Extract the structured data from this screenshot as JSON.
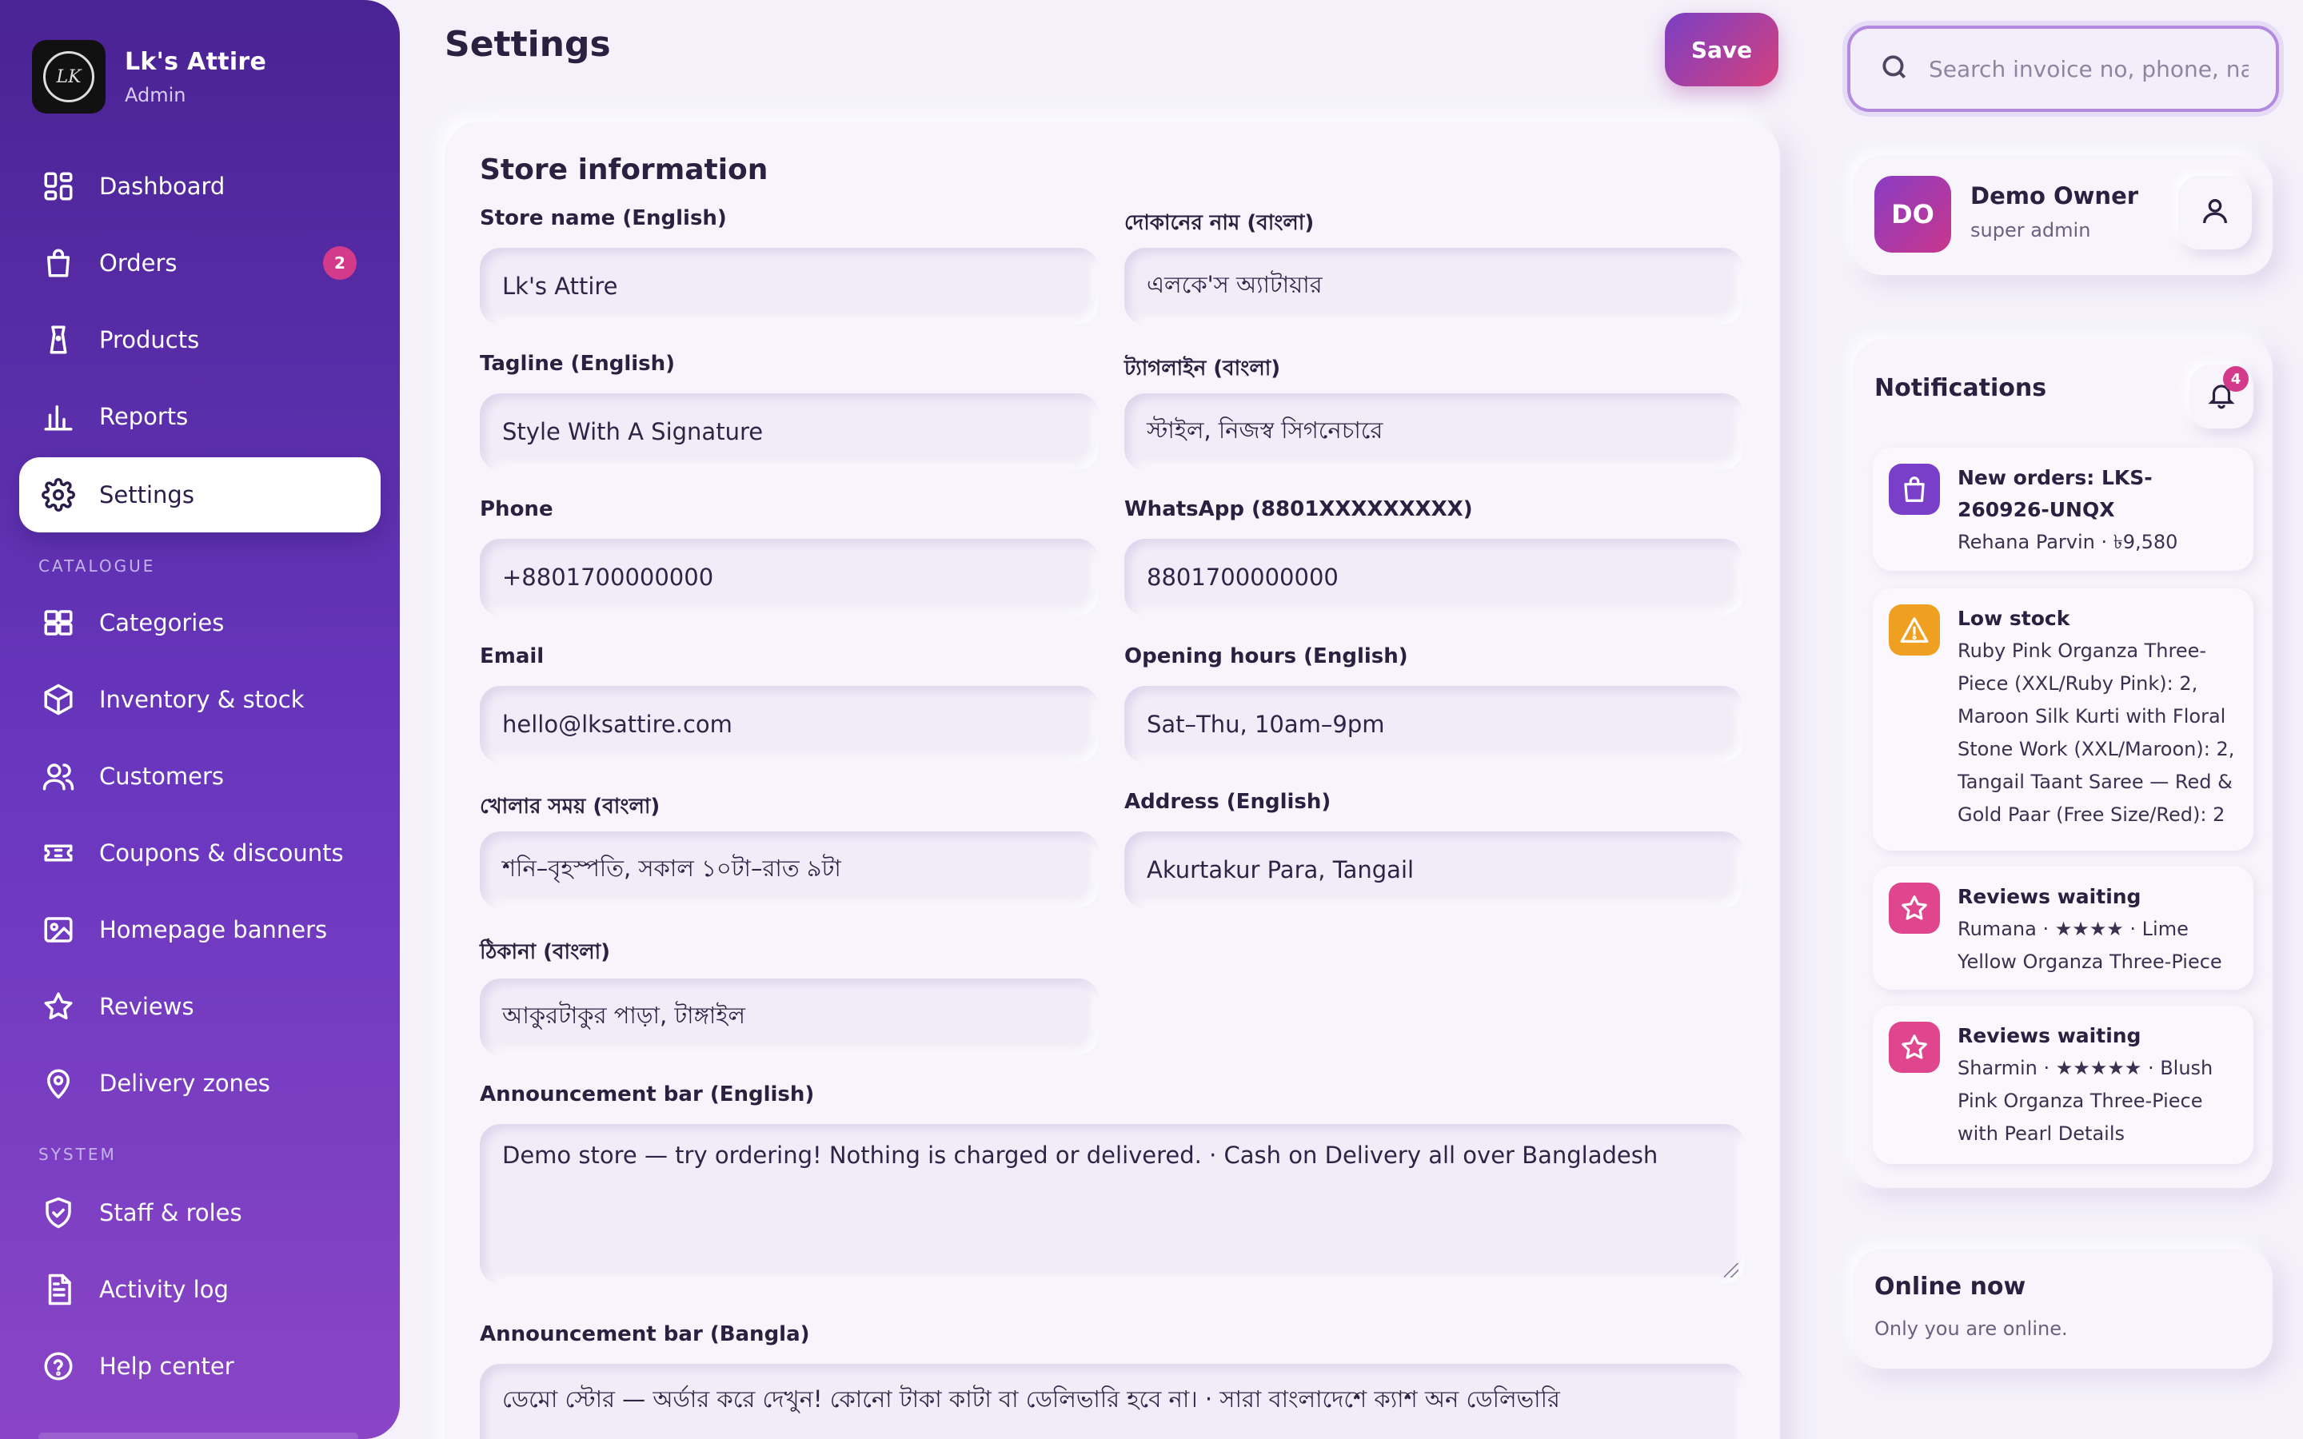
{
  "brand": {
    "name": "Lk's Attire",
    "role": "Admin",
    "logo_text": "LK"
  },
  "nav": {
    "main": [
      {
        "label": "Dashboard",
        "icon": "dashboard-icon"
      },
      {
        "label": "Orders",
        "icon": "shopping-bag-icon",
        "badge": "2"
      },
      {
        "label": "Products",
        "icon": "tag-icon"
      },
      {
        "label": "Reports",
        "icon": "bar-chart-icon"
      },
      {
        "label": "Settings",
        "icon": "gear-icon",
        "active": true
      }
    ],
    "catalogue_heading": "CATALOGUE",
    "catalogue": [
      {
        "label": "Categories",
        "icon": "grid-icon"
      },
      {
        "label": "Inventory & stock",
        "icon": "box-icon"
      },
      {
        "label": "Customers",
        "icon": "users-icon"
      },
      {
        "label": "Coupons & discounts",
        "icon": "ticket-icon"
      },
      {
        "label": "Homepage banners",
        "icon": "image-icon"
      },
      {
        "label": "Reviews",
        "icon": "star-icon"
      },
      {
        "label": "Delivery zones",
        "icon": "map-pin-icon"
      }
    ],
    "system_heading": "SYSTEM",
    "system": [
      {
        "label": "Staff & roles",
        "icon": "shield-icon"
      },
      {
        "label": "Activity log",
        "icon": "document-icon"
      },
      {
        "label": "Help center",
        "icon": "help-icon"
      }
    ]
  },
  "header": {
    "title": "Settings",
    "save_label": "Save"
  },
  "store": {
    "section_title": "Store information",
    "fields": {
      "name_en": {
        "label": "Store name (English)",
        "value": "Lk's Attire"
      },
      "name_bn": {
        "label": "দোকানের নাম (বাংলা)",
        "value": "এলকে'স অ্যাটায়ার"
      },
      "tagline_en": {
        "label": "Tagline (English)",
        "value": "Style With A Signature"
      },
      "tagline_bn": {
        "label": "ট্যাগলাইন (বাংলা)",
        "value": "স্টাইল, নিজস্ব সিগনেচারে"
      },
      "phone": {
        "label": "Phone",
        "value": "+8801700000000"
      },
      "whatsapp": {
        "label": "WhatsApp (8801XXXXXXXXX)",
        "value": "8801700000000"
      },
      "email": {
        "label": "Email",
        "value": "hello@lksattire.com"
      },
      "hours_en": {
        "label": "Opening hours (English)",
        "value": "Sat–Thu, 10am–9pm"
      },
      "hours_bn": {
        "label": "খোলার সময় (বাংলা)",
        "value": "শনি–বৃহস্পতি, সকাল ১০টা–রাত ৯টা"
      },
      "address_en": {
        "label": "Address (English)",
        "value": "Akurtakur Para, Tangail"
      },
      "address_bn": {
        "label": "ঠিকানা (বাংলা)",
        "value": "আকুরটাকুর পাড়া, টাঙ্গাইল"
      },
      "announce_en": {
        "label": "Announcement bar (English)",
        "value": "Demo store — try ordering! Nothing is charged or delivered. · Cash on Delivery all over Bangladesh"
      },
      "announce_bn": {
        "label": "Announcement bar (Bangla)",
        "value": "ডেমো স্টোর — অর্ডার করে দেখুন! কোনো টাকা কাটা বা ডেলিভারি হবে না। · সারা বাংলাদেশে ক্যাশ অন ডেলিভারি"
      }
    }
  },
  "search": {
    "placeholder": "Search invoice no, phone, name"
  },
  "owner": {
    "initials": "DO",
    "name": "Demo Owner",
    "role": "super admin"
  },
  "notifications": {
    "title": "Notifications",
    "count": "4",
    "items": [
      {
        "icon": "shopping-bag-icon",
        "color": "#7a3fc8",
        "title": "New orders: LKS-260926-UNQX",
        "text": "Rehana Parvin · ৳9,580"
      },
      {
        "icon": "warning-icon",
        "color": "#f0a020",
        "title": "Low stock",
        "text": "Ruby Pink Organza Three-Piece (XXL/Ruby Pink): 2, Maroon Silk Kurti with Floral Stone Work (XXL/Maroon): 2, Tangail Taant Saree — Red & Gold Paar (Free Size/Red): 2"
      },
      {
        "icon": "star-icon",
        "color": "#e0468e",
        "title": "Reviews waiting",
        "text": "Rumana · ★★★★ · Lime Yellow Organza Three-Piece"
      },
      {
        "icon": "star-icon",
        "color": "#e0468e",
        "title": "Reviews waiting",
        "text": "Sharmin · ★★★★★ · Blush Pink Organza Three-Piece with Pearl Details"
      }
    ]
  },
  "online": {
    "title": "Online now",
    "subtitle": "Only you are online."
  },
  "colors": {
    "accent": "#6a37bf",
    "badge": "#d43a8a",
    "warning": "#f0a020"
  }
}
